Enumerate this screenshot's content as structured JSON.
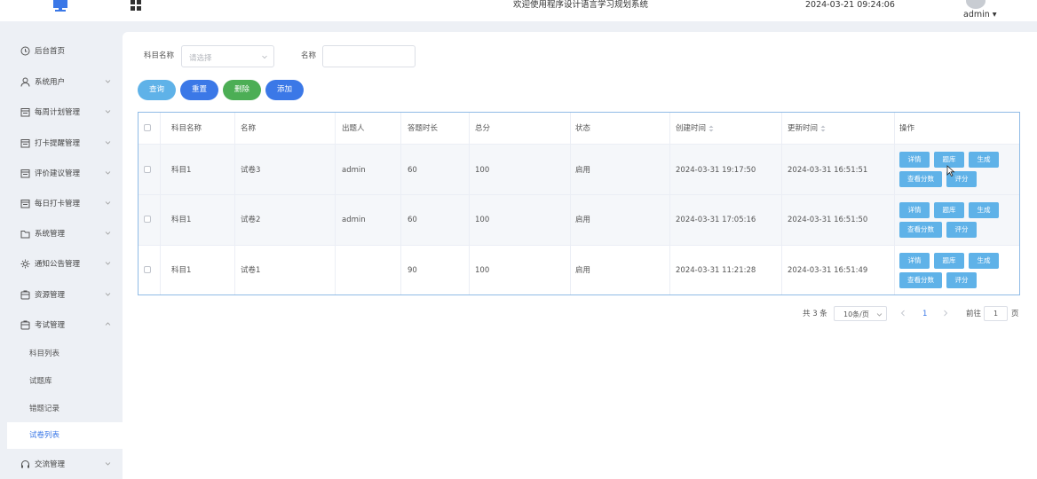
{
  "header": {
    "welcome": "欢迎使用程序设计语言学习规划系统",
    "datetime": "2024-03-21 09:24:06",
    "user": "admin ▾"
  },
  "sidebar": {
    "items": [
      {
        "label": "后台首页",
        "icon": "clock-icon"
      },
      {
        "label": "系统用户",
        "icon": "user-icon"
      },
      {
        "label": "每周计划管理",
        "icon": "calendar-icon"
      },
      {
        "label": "打卡提醒管理",
        "icon": "calendar-icon"
      },
      {
        "label": "评价建议管理",
        "icon": "calendar-icon"
      },
      {
        "label": "每日打卡管理",
        "icon": "calendar-icon"
      },
      {
        "label": "系统管理",
        "icon": "folder-icon"
      },
      {
        "label": "通知公告管理",
        "icon": "sun-icon"
      },
      {
        "label": "资源管理",
        "icon": "box-icon"
      },
      {
        "label": "考试管理",
        "icon": "box-icon"
      },
      {
        "label": "交流管理",
        "icon": "headset-icon"
      }
    ],
    "sub_items": [
      {
        "label": "科目列表"
      },
      {
        "label": "试题库"
      },
      {
        "label": "错题记录"
      },
      {
        "label": "试卷列表"
      }
    ]
  },
  "filters": {
    "subject_label": "科目名称",
    "subject_placeholder": "请选择",
    "name_label": "名称"
  },
  "buttons": {
    "query": "查询",
    "reset": "重置",
    "delete": "删除",
    "add": "添加"
  },
  "table": {
    "headers": [
      "科目名称",
      "名称",
      "出题人",
      "答题时长",
      "总分",
      "状态",
      "创建时间",
      "更新时间",
      "操作"
    ],
    "rows": [
      {
        "subject": "科目1",
        "name": "试卷3",
        "author": "admin",
        "duration": "60",
        "total": "100",
        "status": "启用",
        "created": "2024-03-31 19:17:50",
        "updated": "2024-03-31 16:51:51"
      },
      {
        "subject": "科目1",
        "name": "试卷2",
        "author": "admin",
        "duration": "60",
        "total": "100",
        "status": "启用",
        "created": "2024-03-31 17:05:16",
        "updated": "2024-03-31 16:51:50"
      },
      {
        "subject": "科目1",
        "name": "试卷1",
        "author": "",
        "duration": "90",
        "total": "100",
        "status": "启用",
        "created": "2024-03-31 11:21:28",
        "updated": "2024-03-31 16:51:49"
      }
    ],
    "op_buttons": {
      "detail": "详情",
      "bank": "题库",
      "generate": "生成",
      "view_score": "查看分数",
      "grade": "评分"
    }
  },
  "pagination": {
    "total": "共 3 条",
    "page_size": "10条/页",
    "current_page": "1",
    "goto_label": "前往",
    "goto_value": "1",
    "page_suffix": "页"
  },
  "colors": {
    "primary": "#3b78e7",
    "light_blue": "#5fb2e8",
    "green": "#4cae55"
  }
}
